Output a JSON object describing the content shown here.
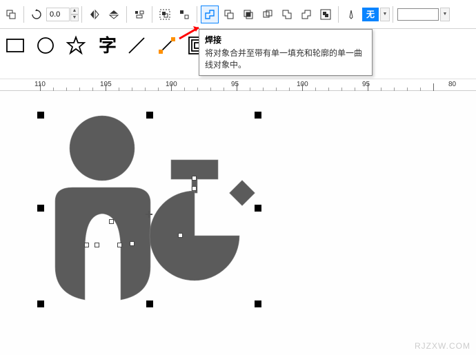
{
  "toolbar": {
    "rotation_value": "0.0",
    "fill_label": "无"
  },
  "tooltip": {
    "title": "焊接",
    "desc": "将对象合并至带有单一填充和轮廓的单一曲线对象中。"
  },
  "ruler": {
    "labels": [
      "110",
      "105",
      "100",
      "95",
      "100",
      "95",
      "80"
    ],
    "positions": [
      50,
      145,
      240,
      335,
      430,
      525,
      650
    ]
  },
  "watermark": "RJZXW.COM"
}
